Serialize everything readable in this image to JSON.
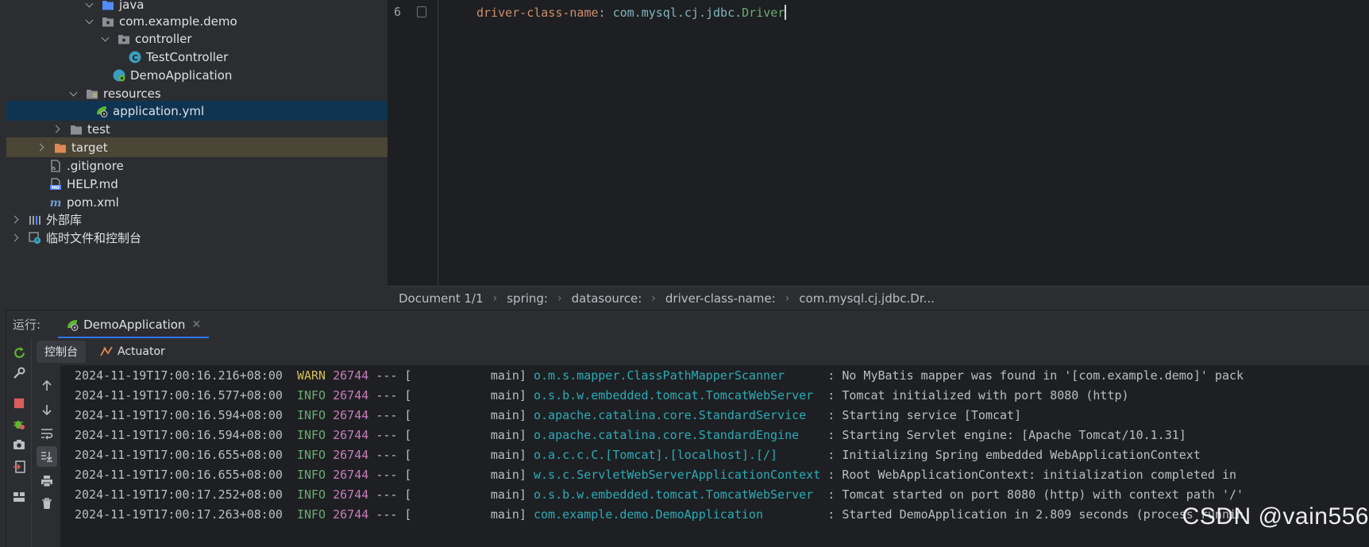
{
  "project_tree": {
    "items": [
      {
        "label": "java",
        "icon": "source-folder-icon"
      },
      {
        "label": "com.example.demo",
        "icon": "package-icon"
      },
      {
        "label": "controller",
        "icon": "package-icon"
      },
      {
        "label": "TestController",
        "icon": "class-icon"
      },
      {
        "label": "DemoApplication",
        "icon": "spring-boot-class-icon"
      },
      {
        "label": "resources",
        "icon": "resources-folder-icon"
      },
      {
        "label": "application.yml",
        "icon": "spring-yaml-icon"
      },
      {
        "label": "test",
        "icon": "folder-icon"
      },
      {
        "label": "target",
        "icon": "excluded-folder-icon"
      },
      {
        "label": ".gitignore",
        "icon": "gitignore-icon"
      },
      {
        "label": "HELP.md",
        "icon": "markdown-icon"
      },
      {
        "label": "pom.xml",
        "icon": "maven-icon"
      },
      {
        "label": "外部库",
        "icon": "libraries-icon"
      },
      {
        "label": "临时文件和控制台",
        "icon": "scratches-icon"
      }
    ]
  },
  "editor": {
    "line_number": "6",
    "key": "driver-class-name",
    "colon": ":",
    "value_prefix": "com.mysql.cj.jdbc.",
    "value_class": "Driver"
  },
  "breadcrumbs": [
    "Document 1/1",
    "spring:",
    "datasource:",
    "driver-class-name:",
    "com.mysql.cj.jdbc.Dr..."
  ],
  "run_panel": {
    "label": "运行:",
    "tab_label": "DemoApplication",
    "subtabs": [
      "控制台",
      "Actuator"
    ]
  },
  "console": {
    "lines": [
      {
        "ts": "2024-11-19T17:00:16.216+08:00",
        "level": "WARN",
        "pid": "26744",
        "sep": "--- [",
        "thread": "main]",
        "logger": "o.m.s.mapper.ClassPathMapperScanner     ",
        "msg": ": No MyBatis mapper was found in '[com.example.demo]' pack"
      },
      {
        "ts": "2024-11-19T17:00:16.577+08:00",
        "level": "INFO",
        "pid": "26744",
        "sep": "--- [",
        "thread": "main]",
        "logger": "o.s.b.w.embedded.tomcat.TomcatWebServer ",
        "msg": ": Tomcat initialized with port 8080 (http)"
      },
      {
        "ts": "2024-11-19T17:00:16.594+08:00",
        "level": "INFO",
        "pid": "26744",
        "sep": "--- [",
        "thread": "main]",
        "logger": "o.apache.catalina.core.StandardService  ",
        "msg": ": Starting service [Tomcat]"
      },
      {
        "ts": "2024-11-19T17:00:16.594+08:00",
        "level": "INFO",
        "pid": "26744",
        "sep": "--- [",
        "thread": "main]",
        "logger": "o.apache.catalina.core.StandardEngine   ",
        "msg": ": Starting Servlet engine: [Apache Tomcat/10.1.31]"
      },
      {
        "ts": "2024-11-19T17:00:16.655+08:00",
        "level": "INFO",
        "pid": "26744",
        "sep": "--- [",
        "thread": "main]",
        "logger": "o.a.c.c.C.[Tomcat].[localhost].[/]      ",
        "msg": ": Initializing Spring embedded WebApplicationContext"
      },
      {
        "ts": "2024-11-19T17:00:16.655+08:00",
        "level": "INFO",
        "pid": "26744",
        "sep": "--- [",
        "thread": "main]",
        "logger": "w.s.c.ServletWebServerApplicationContext",
        "msg": ": Root WebApplicationContext: initialization completed in"
      },
      {
        "ts": "2024-11-19T17:00:17.252+08:00",
        "level": "INFO",
        "pid": "26744",
        "sep": "--- [",
        "thread": "main]",
        "logger": "o.s.b.w.embedded.tomcat.TomcatWebServer ",
        "msg": ": Tomcat started on port 8080 (http) with context path '/'"
      },
      {
        "ts": "2024-11-19T17:00:17.263+08:00",
        "level": "INFO",
        "pid": "26744",
        "sep": "--- [",
        "thread": "main]",
        "logger": "com.example.demo.DemoApplication        ",
        "msg": ": Started DemoApplication in 2.809 seconds (process runnin"
      }
    ]
  },
  "watermark": "CSDN @vain556",
  "colors": {
    "background": "#2b2d30",
    "editor_bg": "#1e1f22",
    "selection": "#0f3451",
    "yaml_key": "#cf8e6d",
    "warn": "#d6bf55",
    "info": "#6aab73",
    "pid": "#c77dbb",
    "logger": "#2aacb8"
  }
}
